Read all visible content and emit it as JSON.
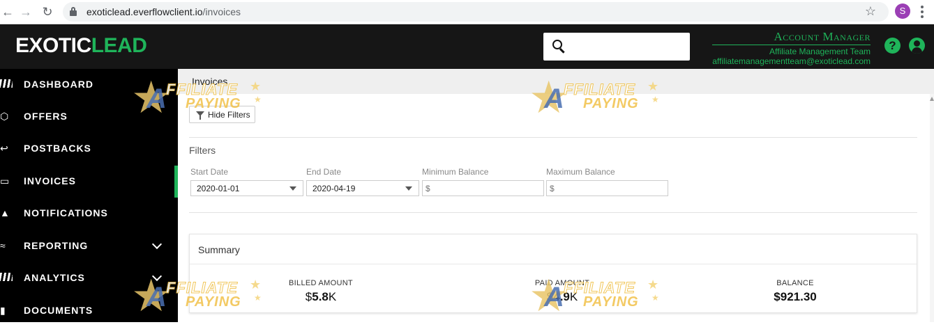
{
  "browser": {
    "back_glyph": "←",
    "forward_glyph": "→",
    "reload_glyph": "↻",
    "url_host": "exoticlead.everflowclient.io",
    "url_path": "/invoices",
    "star_glyph": "☆",
    "profile_initial": "S"
  },
  "header": {
    "logo_exotic": "EXOTIC",
    "logo_lead": "LEAD",
    "account_manager_title": "Account Manager",
    "account_manager_team": "Affiliate Management Team",
    "account_manager_email": "affiliatemanagementteam@exoticlead.com",
    "help_glyph": "?"
  },
  "sidebar": {
    "items": [
      {
        "label": "DASHBOARD",
        "icon": "dashboard-icon"
      },
      {
        "label": "OFFERS",
        "icon": "offers-icon"
      },
      {
        "label": "POSTBACKS",
        "icon": "postbacks-icon"
      },
      {
        "label": "INVOICES",
        "icon": "invoices-icon",
        "active": true
      },
      {
        "label": "NOTIFICATIONS",
        "icon": "bell-icon"
      },
      {
        "label": "REPORTING",
        "icon": "reporting-icon",
        "expandable": true
      },
      {
        "label": "ANALYTICS",
        "icon": "analytics-icon",
        "expandable": true
      },
      {
        "label": "DOCUMENTS",
        "icon": "document-icon"
      }
    ]
  },
  "main": {
    "title": "Invoices",
    "hide_filters_label": "Hide Filters",
    "filters_title": "Filters",
    "filters": {
      "start_date_label": "Start Date",
      "start_date_value": "2020-01-01",
      "end_date_label": "End Date",
      "end_date_value": "2020-04-19",
      "min_balance_label": "Minimum Balance",
      "min_balance_placeholder": "$",
      "max_balance_label": "Maximum Balance",
      "max_balance_placeholder": "$"
    },
    "summary": {
      "title": "Summary",
      "billed_label": "BILLED AMOUNT",
      "billed_currency": "$",
      "billed_value": "5.8",
      "billed_suffix": "K",
      "paid_label": "PAID AMOUNT",
      "paid_currency": "$",
      "paid_value": "4.9",
      "paid_suffix": "K",
      "balance_label": "BALANCE",
      "balance_currency": "$",
      "balance_value": "921.30"
    }
  },
  "watermark": {
    "letter": "A",
    "line1": "FFILIATE",
    "line2": "PAYING"
  },
  "colors": {
    "accent_green": "#1fb45a",
    "header_bg": "#161616",
    "sidebar_bg": "#000000"
  }
}
